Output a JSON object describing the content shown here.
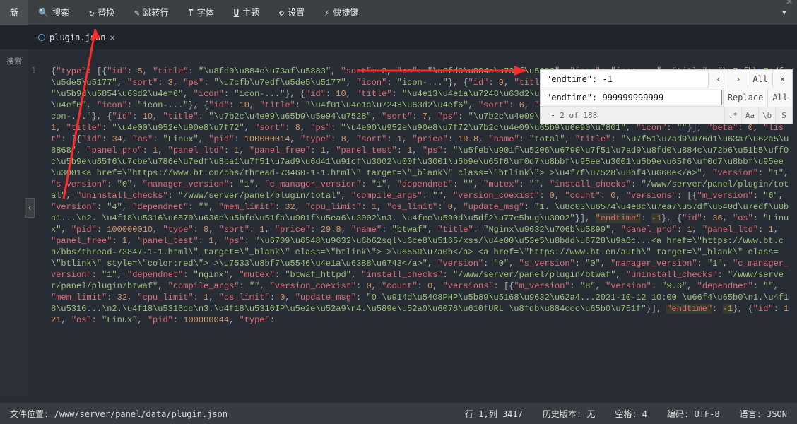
{
  "topbar": {
    "new": "新",
    "search": "搜索",
    "replace": "替换",
    "goto": "跳转行",
    "font": "字体",
    "theme": "主题",
    "settings": "设置",
    "shortcuts": "快捷键"
  },
  "tab": {
    "filename": "plugin.json"
  },
  "sidebar": {
    "search": "搜索"
  },
  "searchbox": {
    "find_value": "\"endtime\": -1",
    "replace_value": "\"endtime\": 999999999999",
    "prev": "‹",
    "next": "›",
    "all": "All",
    "close": "×",
    "replace_btn": "Replace",
    "replace_all": "All",
    "minus": "-",
    "count": "2 of 188",
    "opt_regex": ".*",
    "opt_case": "Aa",
    "opt_word": "\\b",
    "opt_sel": "S"
  },
  "statusbar": {
    "path_label": "文件位置:",
    "path": "/www/server/panel/data/plugin.json",
    "rowcol_label": "行",
    "rowcol": "1,列 3417",
    "history_label": "历史版本:",
    "history": "无",
    "space_label": "空格:",
    "space": "4",
    "encoding_label": "编码:",
    "encoding": "UTF-8",
    "lang_label": "语言:",
    "lang": "JSON"
  },
  "editor_text": "{\"type\": [{\"id\": 5, \"title\": \"\\u8fd0\\u884c\\u73af\\u5883\", \"sort\": 2, \"ps\": \"\\u8fd0\\u884c\\u73af\\u5883\", \"icon\": \"icon-...\", \"title\": \"\\u7cfb\\u7edf\\u5de5\\u5177\", \"sort\": 3, \"ps\": \"\\u7cfb\\u7edf\\u5de5\\u5177\", \"icon\": \"icon-...\"}, {\"id\": 9, \"title\": \"\\u5b9d\\u5854\\u63d2\\u4ef6\", \"sort\": 4, \"ps\": \"\\u5b9d\\u5854\\u63d2\\u4ef6\", \"icon\": \"icon-...\"}, {\"id\": 10, \"title\": \"\\u4e13\\u4e1a\\u7248\\u63d2\\u4ef6\", \"sort\": 5, \"ps\": \"\\u4e13\\u4e1a\\u7248\\u63d2\\u4ef6\", \"icon\": \"icon-...\"}, {\"id\": 10, \"title\": \"\\u4f01\\u4e1a\\u7248\\u63d2\\u4ef6\", \"sort\": 6, \"ps\": \"\\u4f01\\u4e1a\\u7248\\u63d2\\u4ef6\", \"icon\": \"icon-...\"}, {\"id\": 10, \"title\": \"\\u7b2c\\u4e09\\u65b9\\u5e94\\u7528\", \"sort\": 7, \"ps\": \"\\u7b2c\\u4e09\\u65b9\\u5e94\\u7528\", \"icon\": \"icon-...\"}, {\"id\": 11, \"title\": \"\\u4e00\\u952e\\u90e8\\u7f72\", \"sort\": 8, \"ps\": \"\\u4e00\\u952e\\u90e8\\u7f72\\u7b2c\\u4e09\\u65b9\\u6e90\\u7801\", \"icon\": \"\"}], \"beta\": 0, \"list\": [{\"id\": 34, \"os\": \"Linux\", \"pid\": 100000014, \"type\": 8, \"sort\": 1, \"price\": 19.8, \"name\": \"total\", \"title\": \"\\u7f51\\u7ad9\\u76d1\\u63a7\\u62a5\\u8868\", \"panel_pro\": 1, \"panel_ltd\": 1, \"panel_free\": 1, \"panel_test\": 1, \"ps\": \"\\u5feb\\u901f\\u5206\\u6790\\u7f51\\u7ad9\\u8fd0\\u884c\\u72b6\\u51b5\\uff0c\\u5b9e\\u65f6\\u7cbe\\u786e\\u7edf\\u8ba1\\u7f51\\u7ad9\\u6d41\\u91cf\\u3002\\u00f\\u3001\\u5b9e\\u65f6\\uf0d7\\u8bbf\\u95ee\\u3001\\u5b9e\\u65f6\\uf0d7\\u8bbf\\u95ee\\u3001<a href=\\\"https://www.bt.cn/bbs/thread-73460-1-1.html\\\" target=\\\"_blank\\\" class=\\\"btlink\\\"> >\\u4f7f\\u7528\\u8bf4\\u660e</a>\", \"version\": \"1\", \"s_version\": \"0\", \"manager_version\": \"1\", \"c_manager_version\": \"1\", \"dependnet\": \"\", \"mutex\": \"\", \"install_checks\": \"/www/server/panel/plugin/total\", \"uninstall_checks\": \"/www/server/panel/plugin/total\", \"compile_args\": \"\", \"version_coexist\": 0, \"count\": 0, \"versions\": [{\"m_version\": \"6\", \"version\": \"4\", \"dependnet\": \"\", \"mem_limit\": 32, \"cpu_limit\": 1, \"os_limit\": 0, \"update_msg\": \"1. \\u8c03\\u6574\\u4e8c\\u7ea7\\u57df\\u540d\\u7edf\\u8ba1...\\n2. \\u4f18\\u5316\\u6570\\u636e\\u5bfc\\u51fa\\u901f\\u5ea6\\u3002\\n3. \\u4fee\\u590d\\u5df2\\u77e5bug\\u3002\"}], \"endtime\": -1}, {\"id\": 36, \"os\": \"Linux\", \"pid\": 100000010, \"type\": 8, \"sort\": 1, \"price\": 29.8, \"name\": \"btwaf\", \"title\": \"Nginx\\u9632\\u706b\\u5899\", \"panel_pro\": 1, \"panel_ltd\": 1, \"panel_free\": 1, \"panel_test\": 1, \"ps\": \"\\u6709\\u6548\\u9632\\u6b62sql\\u6ce8\\u5165/xss/\\u4e00\\u53e5\\u8bdd\\u6728\\u9a6c...<a href=\\\"https://www.bt.cn/bbs/thread-73847-1-1.html\\\" target=\\\"_blank\\\" class=\\\"btlink\\\"> >\\u6559\\u7a0b</a> <a href=\\\"https://www.bt.cn/auth\\\" target=\\\"_blank\\\" class=\\\"btlink\\\" style=\\\"color:red\\\"> >\\u7533\\u8bf7\\u5546\\u4e1a\\u6388\\u6743</a>\", \"version\": \"0\", \"s_version\": \"0\", \"manager_version\": \"1\", \"c_manager_version\": \"1\", \"dependnet\": \"nginx\", \"mutex\": \"btwaf_httpd\", \"install_checks\": \"/www/server/panel/plugin/btwaf\", \"uninstall_checks\": \"/www/server/panel/plugin/btwaf\", \"compile_args\": \"\", \"version_coexist\": 0, \"count\": 0, \"versions\": [{\"m_version\": \"8\", \"version\": \"9.6\", \"dependnet\": \"\", \"mem_limit\": 32, \"cpu_limit\": 1, \"os_limit\": 0, \"update_msg\": \"0 \\u914d\\u5408PHP\\u5b89\\u5168\\u9632\\u62a4...2021-10-12 10:00 \\u66f4\\u65b0\\n1.\\u4f18\\u5316...\\n2.\\u4f18\\u5316cc\\n3.\\u4f18\\u5316IP\\u5e2e\\u52a9\\n4.\\u589e\\u52a0\\u6076\\u610fURL \\u8fdb\\u884ccc\\u65b0\\u751f\"}], \"endtime\": -1}, {\"id\": 121, \"os\": \"Linux\", \"pid\": 100000044, \"type\":",
  "chart_data": null
}
